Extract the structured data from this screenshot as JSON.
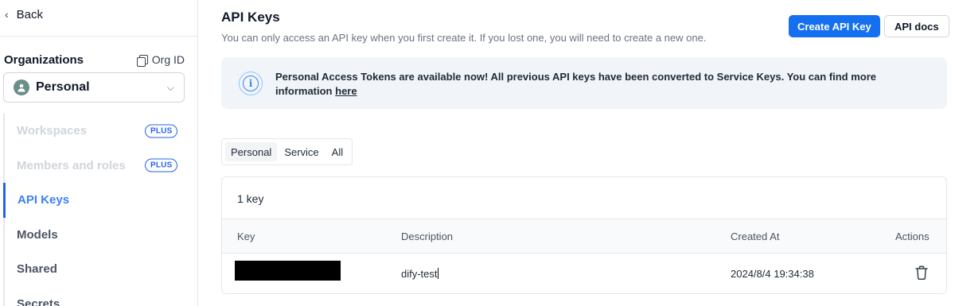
{
  "sidebar": {
    "back_label": "Back",
    "organizations_label": "Organizations",
    "org_id_label": "Org ID",
    "org_selected": "Personal",
    "plus_badge": "PLUS",
    "items": [
      {
        "label": "Workspaces",
        "state": "disabled",
        "badge": true
      },
      {
        "label": "Members and roles",
        "state": "disabled",
        "badge": true
      },
      {
        "label": "API Keys",
        "state": "active",
        "badge": false
      },
      {
        "label": "Models",
        "state": "normal",
        "badge": false
      },
      {
        "label": "Shared",
        "state": "normal",
        "badge": false
      },
      {
        "label": "Secrets",
        "state": "normal",
        "badge": false
      }
    ]
  },
  "header": {
    "title": "API Keys",
    "subtitle": "You can only access an API key when you first create it. If you lost one, you will need to create a new one.",
    "create_button": "Create API Key",
    "docs_button": "API docs"
  },
  "notice": {
    "text": "Personal Access Tokens are available now! All previous API keys have been converted to Service Keys. You can find more information",
    "link": "here"
  },
  "tabs": [
    "Personal",
    "Service",
    "All"
  ],
  "active_tab": "Personal",
  "table": {
    "count_label": "1 key",
    "columns": {
      "key": "Key",
      "description": "Description",
      "created_at": "Created At",
      "actions": "Actions"
    },
    "rows": [
      {
        "description": "dify-test",
        "created_at": "2024/8/4 19:34:38"
      }
    ]
  },
  "colors": {
    "accent": "#1570ef",
    "active_nav": "#3b82f6",
    "notice_bg": "#f1f4f8"
  },
  "icons": {
    "back": "chevron-left-icon",
    "copy": "copy-icon",
    "avatar": "user-icon",
    "caret": "chevron-down-icon",
    "info": "info-icon",
    "delete": "trash-icon"
  }
}
